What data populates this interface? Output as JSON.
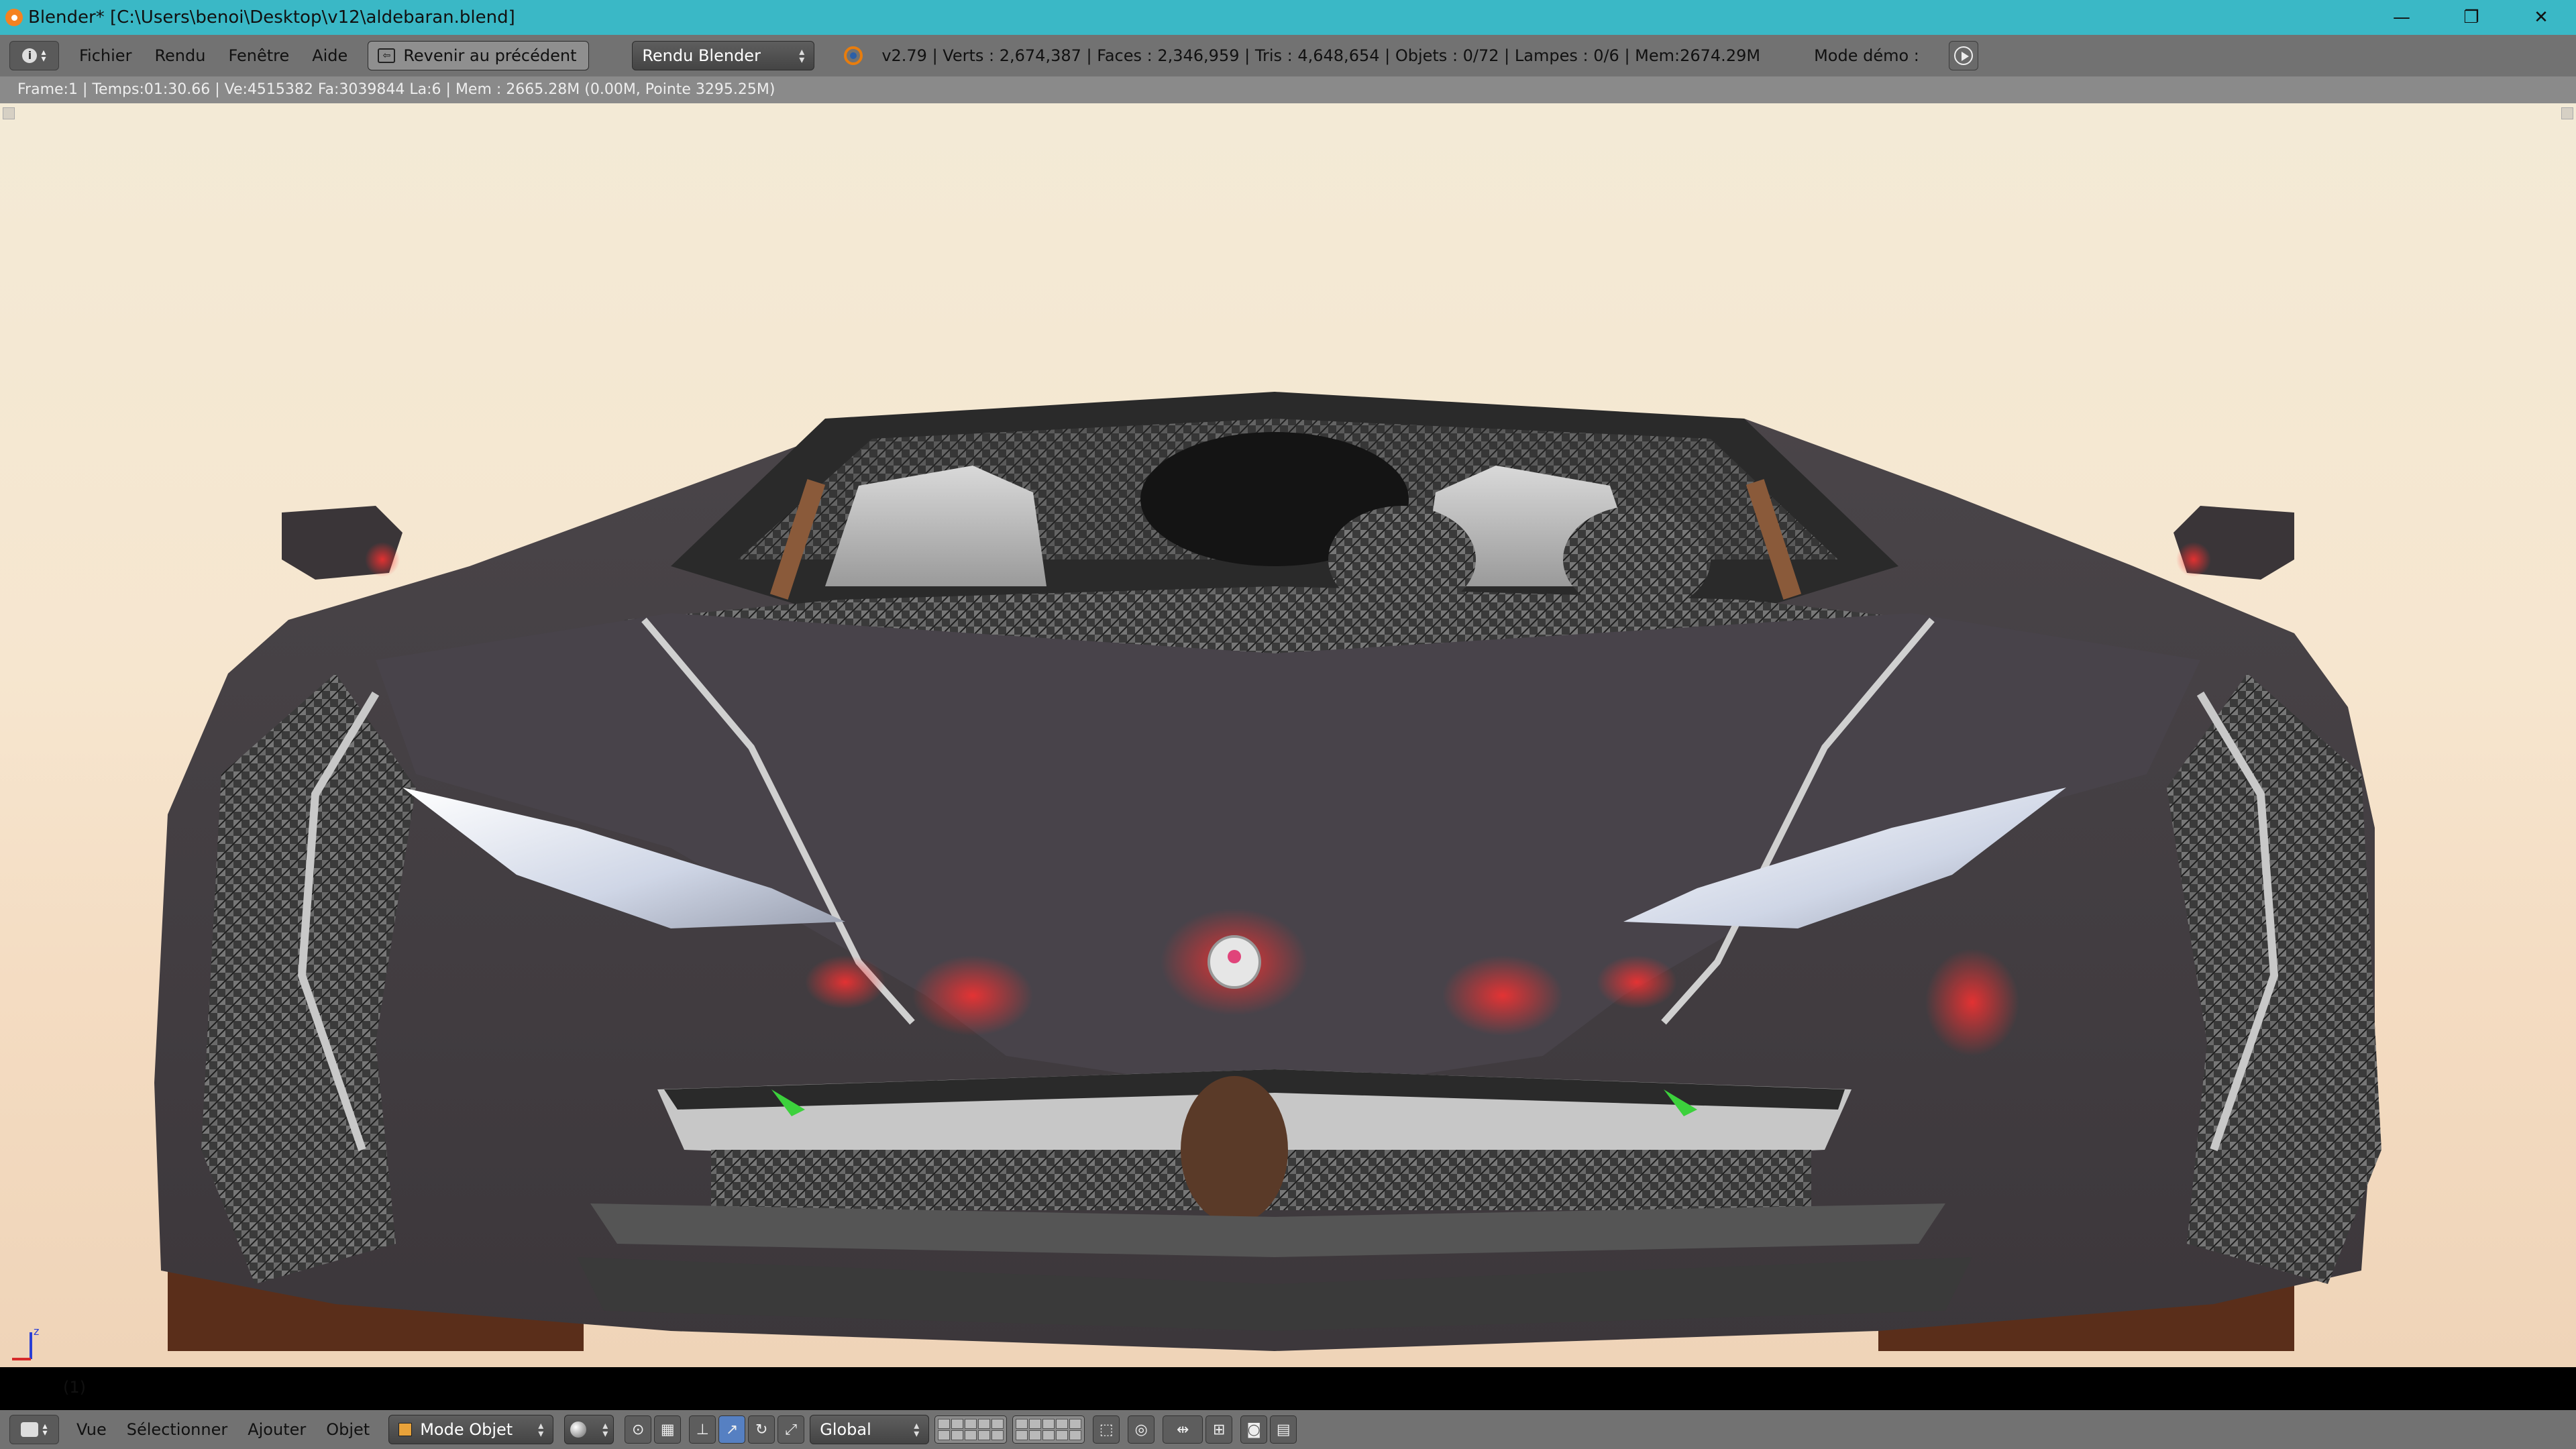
{
  "window": {
    "title": "Blender* [C:\\Users\\benoi\\Desktop\\v12\\aldebaran.blend]",
    "minimize_glyph": "—",
    "maximize_glyph": "❐",
    "close_glyph": "✕"
  },
  "info_header": {
    "editor_icon": "info-icon",
    "menus": [
      "Fichier",
      "Rendu",
      "Fenêtre",
      "Aide"
    ],
    "back_button": "Revenir au précédent",
    "render_engine": "Rendu Blender",
    "scene_stats": "v2.79 | Verts   : 2,674,387 | Faces   : 2,346,959 | Tris   : 4,648,654 | Objets   : 0/72 | Lampes   : 0/6 | Mem:2674.29M",
    "demo_mode_label": "Mode démo   :",
    "play_icon": "play-icon"
  },
  "render_status": "Frame:1 | Temps:01:30.66 | Ve:4515382 Fa:3039844 La:6 | Mem   : 2665.28M (0.00M, Pointe 3295.25M)",
  "viewport": {
    "frame_label": "(1)",
    "axis_z": "z",
    "subject": "car-render"
  },
  "bottom_header": {
    "editor_icon": "3d-view-icon",
    "menus": [
      "Vue",
      "Sélectionner",
      "Ajouter",
      "Objet"
    ],
    "mode": "Mode Objet",
    "orientation": "Global"
  },
  "colors": {
    "titlebar": "#3ab8c6",
    "header": "#727272",
    "status_strip": "#8a8a8a",
    "accent": "#5680c2"
  }
}
